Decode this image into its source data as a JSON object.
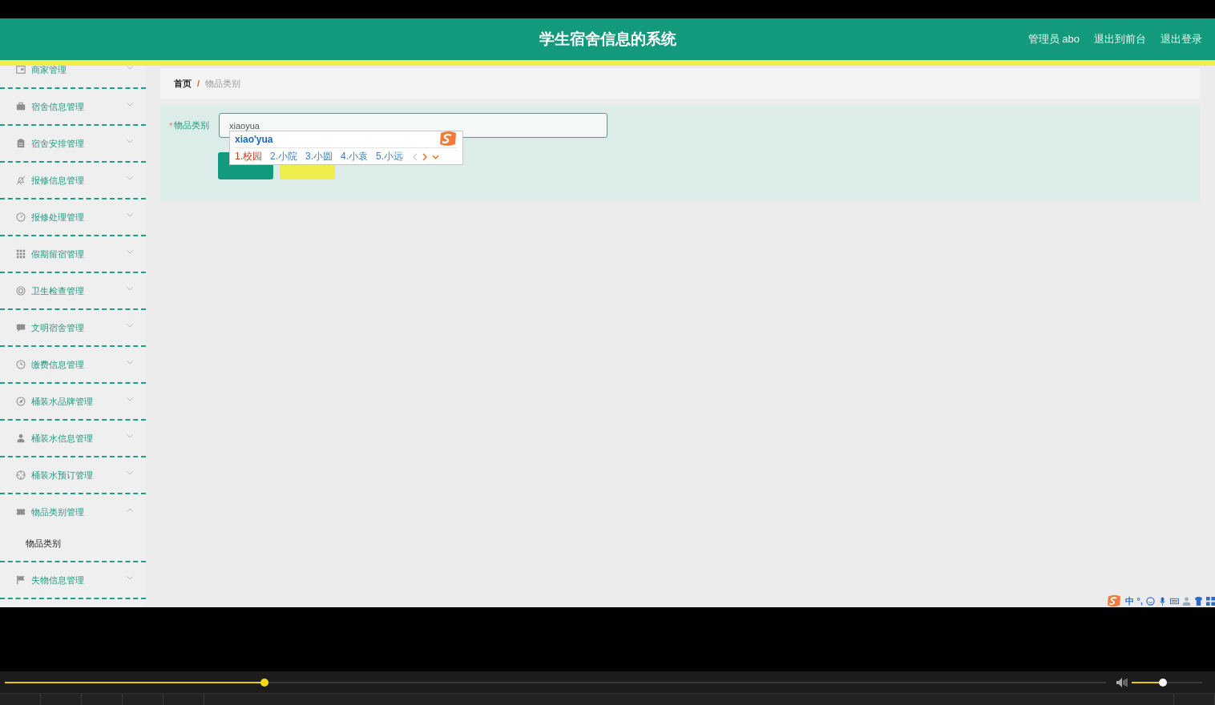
{
  "header": {
    "title": "学生宿舍信息的系统",
    "links": [
      "管理员 abo",
      "退出到前台",
      "退出登录"
    ]
  },
  "sidebar": {
    "items": [
      {
        "label": "商家管理",
        "expanded": false
      },
      {
        "label": "宿舍信息管理",
        "expanded": false
      },
      {
        "label": "宿舍安排管理",
        "expanded": false
      },
      {
        "label": "报修信息管理",
        "expanded": false
      },
      {
        "label": "报修处理管理",
        "expanded": false
      },
      {
        "label": "假期留宿管理",
        "expanded": false
      },
      {
        "label": "卫生检查管理",
        "expanded": false
      },
      {
        "label": "文明宿舍管理",
        "expanded": false
      },
      {
        "label": "缴费信息管理",
        "expanded": false
      },
      {
        "label": "桶装水品牌管理",
        "expanded": false
      },
      {
        "label": "桶装水信息管理",
        "expanded": false
      },
      {
        "label": "桶装水预订管理",
        "expanded": false
      },
      {
        "label": "物品类别管理",
        "expanded": true,
        "children": [
          {
            "label": "物品类别"
          }
        ]
      },
      {
        "label": "失物信息管理",
        "expanded": false
      }
    ]
  },
  "breadcrumb": {
    "items": [
      "首页",
      "物品类别"
    ],
    "separator": "/"
  },
  "form": {
    "field": {
      "required_mark": "*",
      "label": "物品类别",
      "value": "xiaoyua"
    },
    "buttons": [
      {
        "kind": "primary"
      },
      {
        "kind": "secondary"
      }
    ]
  },
  "ime": {
    "composition": "xiao'yua",
    "candidates": [
      {
        "label": "1.校园",
        "selected": true
      },
      {
        "label": "2.小院",
        "selected": false
      },
      {
        "label": "3.小圆",
        "selected": false
      },
      {
        "label": "4.小袁",
        "selected": false
      },
      {
        "label": "5.小远",
        "selected": false
      }
    ],
    "tray": [
      "中",
      "°,"
    ]
  },
  "player": {
    "progress": {
      "level": 0.236
    },
    "volume": {
      "level": 0.44
    }
  }
}
